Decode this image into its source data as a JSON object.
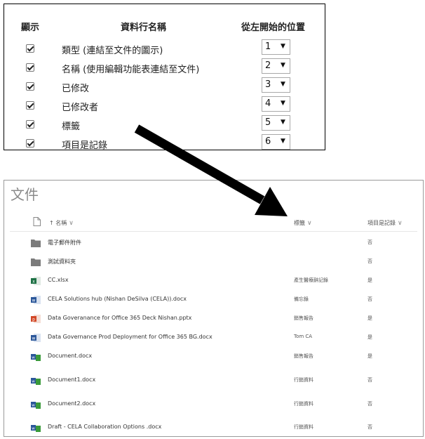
{
  "settings": {
    "headers": {
      "show": "顯示",
      "column_name": "資料行名稱",
      "position": "從左開始的位置"
    },
    "rows": [
      {
        "label": "類型 (連結至文件的圖示)",
        "position": "1",
        "checked": true
      },
      {
        "label": "名稱 (使用編輯功能表連結至文件)",
        "position": "2",
        "checked": true
      },
      {
        "label": "已修改",
        "position": "3",
        "checked": true
      },
      {
        "label": "已修改者",
        "position": "4",
        "checked": true
      },
      {
        "label": "標籤",
        "position": "5",
        "checked": true
      },
      {
        "label": "項目是記錄",
        "position": "6",
        "checked": true
      }
    ],
    "dropdown_arrow": "▼"
  },
  "library": {
    "title": "文件",
    "columns": {
      "name": "↑ 名稱",
      "tags": "標籤",
      "is_record": "項目是記錄"
    },
    "chevron": "∨",
    "files": [
      {
        "icon": "folder-icon",
        "name": "電子郵件附件",
        "tag": "",
        "record": "否"
      },
      {
        "icon": "folder-icon",
        "name": "測試資料夾",
        "tag": "",
        "record": "否"
      },
      {
        "icon": "excel-icon",
        "name": "CC.xlsx",
        "tag": "產生醫療辭記錄",
        "record": "是"
      },
      {
        "icon": "word-icon",
        "name": "CELA Solutions hub (Nishan DeSilva (CELA)).docx",
        "tag": "備忘錄",
        "record": "否"
      },
      {
        "icon": "powerpoint-icon",
        "name": "Data Goveranance for Office 365 Deck Nishan.pptx",
        "tag": "銷售報告",
        "record": "是"
      },
      {
        "icon": "word-icon",
        "name": "Data Governance Prod Deployment for Office 365 BG.docx",
        "tag": "Tom CA",
        "record": "是"
      },
      {
        "icon": "word-doc-icon",
        "name": "Document.docx",
        "tag": "銷售報告",
        "record": "是"
      },
      {
        "icon": "word-doc-icon",
        "name": "Document1.docx",
        "tag": "行銷資料",
        "record": "否"
      },
      {
        "icon": "word-doc-icon",
        "name": "Document2.docx",
        "tag": "行銷資料",
        "record": "否"
      },
      {
        "icon": "word-doc-icon",
        "name": "Draft - CELA Collaboration Options .docx",
        "tag": "行銷資料",
        "record": "否"
      }
    ]
  },
  "colors": {
    "folder": "#7b7b7b",
    "excel": "#1e7145",
    "word": "#2b579a",
    "powerpoint": "#d24726",
    "arrow": "#000000"
  }
}
